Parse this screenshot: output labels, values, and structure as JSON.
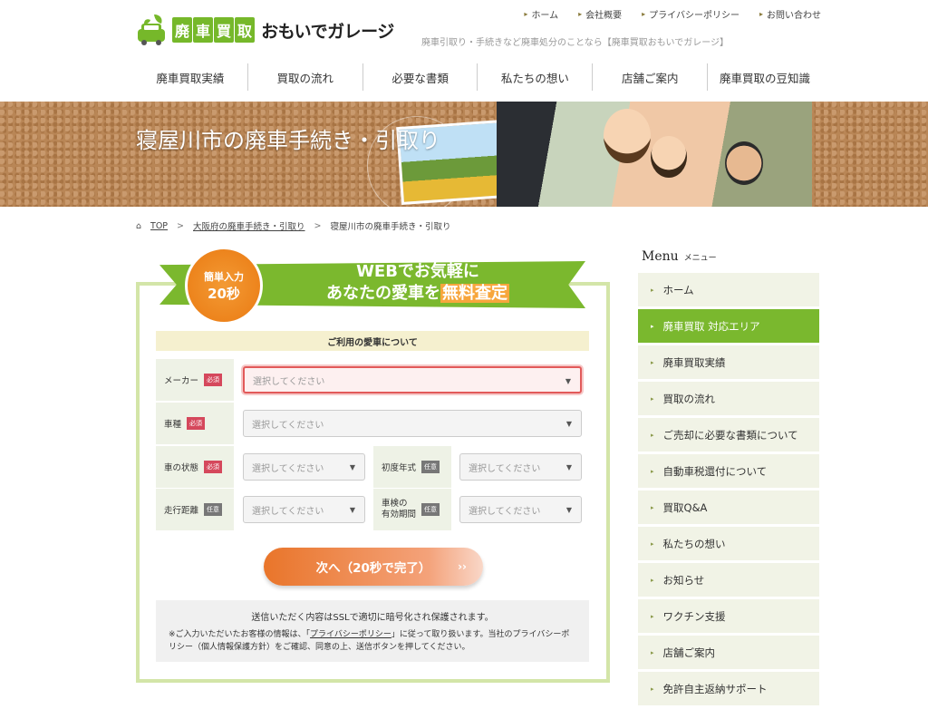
{
  "header": {
    "top_links": [
      "ホーム",
      "会社概要",
      "プライバシーポリシー",
      "お問い合わせ"
    ],
    "logo_badge": [
      "廃",
      "車",
      "買",
      "取"
    ],
    "logo_name": "おもいでガレージ",
    "tagline": "廃車引取り・手続きなど廃車処分のことなら【廃車買取おもいでガレージ】"
  },
  "global_nav": [
    "廃車買取実績",
    "買取の流れ",
    "必要な書類",
    "私たちの想い",
    "店舗ご案内",
    "廃車買取の豆知識"
  ],
  "hero": {
    "title": "寝屋川市の廃車手続き・引取り"
  },
  "breadcrumb": {
    "top": "TOP",
    "sep": ">",
    "pref": "大阪府の廃車手続き・引取り",
    "current": "寝屋川市の廃車手続き・引取り"
  },
  "form": {
    "badge_line1": "簡単入力",
    "badge_line2": "20秒",
    "headline_1": "WEBでお気軽に",
    "headline_2a": "あなたの愛車を",
    "headline_2b": "無料査定",
    "section_title": "ご利用の愛車について",
    "required": "必須",
    "optional": "任意",
    "maker_label": "メーカー",
    "model_label": "車種",
    "condition_label": "車の状態",
    "year_label": "初度年式",
    "mileage_label": "走行距離",
    "inspection_label_1": "車検の",
    "inspection_label_2": "有効期間",
    "placeholder": "選択してください",
    "caret": "▼",
    "next_label": "次へ（20秒で完了）",
    "next_chevron": "››",
    "note_1": "送信いただく内容はSSLで適切に暗号化され保護されます。",
    "note_2a": "※ご入力いただいたお客様の情報は、「",
    "note_2_link": "プライバシーポリシー",
    "note_2b": "」に従って取り扱います。当社のプライバシーポリシー（個人情報保護方針）をご確認、同意の上、送信ボタンを押してください。"
  },
  "side_menu": {
    "title_en": "Menu",
    "title_jp": "メニュー",
    "items": [
      "ホーム",
      "廃車買取 対応エリア",
      "廃車買取実績",
      "買取の流れ",
      "ご売却に必要な書類について",
      "自動車税還付について",
      "買取Q&A",
      "私たちの想い",
      "お知らせ",
      "ワクチン支援",
      "店舗ご案内",
      "免許自主返納サポート"
    ],
    "active_index": 1
  },
  "colors": {
    "brand_green": "#7ab82e",
    "accent_orange": "#e9752a",
    "required_red": "#d5485c"
  },
  "icons": {
    "menu_arrow": "▸",
    "home_icon": "⌂",
    "link_arrow": "▸"
  }
}
